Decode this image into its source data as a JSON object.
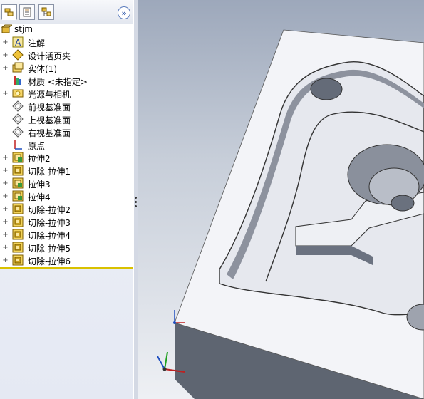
{
  "panel": {
    "tabs": [
      {
        "name": "feature-manager",
        "icon": "feature-tree-icon"
      },
      {
        "name": "property-manager",
        "icon": "property-sheet-icon"
      },
      {
        "name": "configuration-manager",
        "icon": "configuration-icon"
      }
    ],
    "expand_label": "»"
  },
  "tree": {
    "root": {
      "label": "stjm",
      "icon": "part-icon"
    },
    "items": [
      {
        "label": "注解",
        "icon": "annotation-icon",
        "expandable": true
      },
      {
        "label": "设计活页夹",
        "icon": "design-binder-icon",
        "expandable": true
      },
      {
        "label": "实体(1)",
        "icon": "solid-bodies-icon",
        "expandable": true
      },
      {
        "label": "材质 <未指定>",
        "icon": "material-icon",
        "expandable": false
      },
      {
        "label": "光源与相机",
        "icon": "lights-cameras-icon",
        "expandable": true
      },
      {
        "label": "前视基准面",
        "icon": "plane-icon",
        "expandable": false
      },
      {
        "label": "上视基准面",
        "icon": "plane-icon",
        "expandable": false
      },
      {
        "label": "右视基准面",
        "icon": "plane-icon",
        "expandable": false
      },
      {
        "label": "原点",
        "icon": "origin-icon",
        "expandable": false
      },
      {
        "label": "拉伸2",
        "icon": "extrude-icon",
        "expandable": true
      },
      {
        "label": "切除-拉伸1",
        "icon": "cut-extrude-icon",
        "expandable": true
      },
      {
        "label": "拉伸3",
        "icon": "extrude-icon",
        "expandable": true
      },
      {
        "label": "拉伸4",
        "icon": "extrude-icon",
        "expandable": true
      },
      {
        "label": "切除-拉伸2",
        "icon": "cut-extrude-icon",
        "expandable": true
      },
      {
        "label": "切除-拉伸3",
        "icon": "cut-extrude-icon",
        "expandable": true
      },
      {
        "label": "切除-拉伸4",
        "icon": "cut-extrude-icon",
        "expandable": true
      },
      {
        "label": "切除-拉伸5",
        "icon": "cut-extrude-icon",
        "expandable": true
      },
      {
        "label": "切除-拉伸6",
        "icon": "cut-extrude-icon",
        "expandable": true
      }
    ]
  },
  "viewport": {
    "model": "3d-mold-block",
    "triad_axes": [
      "X",
      "Y",
      "Z"
    ]
  }
}
